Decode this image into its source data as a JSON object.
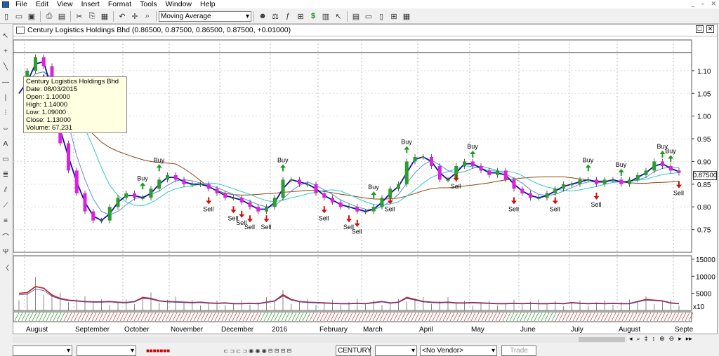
{
  "menu": [
    "File",
    "Edit",
    "View",
    "Insert",
    "Format",
    "Tools",
    "Window",
    "Help"
  ],
  "toolbar": {
    "indicator_select": "Moving Average"
  },
  "chart_window": {
    "title": "Century Logistics Holdings Bhd (0.86500, 0.87500, 0.86500, 0.87500, +0.01000)"
  },
  "tooltip": {
    "name": "Century Logistics Holdings Bhd",
    "date": "Date: 08/03/2015",
    "open": "Open: 1.10000",
    "high": "High: 1.14000",
    "low": "Low: 1.09000",
    "close": "Close: 1.13000",
    "volume": "Volume: 67,231"
  },
  "last_price": "0.87500",
  "volume_multiplier": "x10",
  "bottom": {
    "exchange": "CENTURY",
    "vendor": "<No Vendor>",
    "trade_label": "Trade"
  },
  "colors": {
    "up": "#2aa02a",
    "down": "#e020e0",
    "ma_fast": "#1010a0",
    "ma_mid": "#30c8c8",
    "ma_slow": "#8b4513",
    "volume_ma": "#cc2222",
    "buy_arrow": "#1a9a1a",
    "sell_arrow": "#d01010"
  },
  "chart_data": {
    "type": "line",
    "price_panel": {
      "ylim": [
        0.7,
        1.14
      ],
      "yticks": [
        "1.10",
        "1.05",
        "1.00",
        "0.95",
        "0.90",
        "0.85",
        "0.80",
        "0.75"
      ],
      "series_close": [
        1.05,
        1.1,
        1.13,
        1.11,
        1.0,
        0.94,
        0.88,
        0.83,
        0.79,
        0.77,
        0.77,
        0.8,
        0.82,
        0.83,
        0.82,
        0.82,
        0.84,
        0.86,
        0.87,
        0.86,
        0.85,
        0.85,
        0.85,
        0.84,
        0.83,
        0.82,
        0.82,
        0.81,
        0.8,
        0.79,
        0.8,
        0.82,
        0.86,
        0.86,
        0.85,
        0.85,
        0.83,
        0.82,
        0.81,
        0.8,
        0.8,
        0.79,
        0.79,
        0.8,
        0.82,
        0.84,
        0.85,
        0.9,
        0.91,
        0.91,
        0.89,
        0.86,
        0.86,
        0.89,
        0.9,
        0.89,
        0.88,
        0.87,
        0.88,
        0.86,
        0.84,
        0.83,
        0.82,
        0.82,
        0.83,
        0.84,
        0.85,
        0.85,
        0.86,
        0.86,
        0.85,
        0.86,
        0.86,
        0.85,
        0.86,
        0.87,
        0.88,
        0.9,
        0.89,
        0.88,
        0.875
      ],
      "ma_labels": [],
      "signals": [
        {
          "i": 3,
          "type": "Sell"
        },
        {
          "i": 15,
          "type": "Buy"
        },
        {
          "i": 17,
          "type": "Buy"
        },
        {
          "i": 23,
          "type": "Sell"
        },
        {
          "i": 26,
          "type": "Sell"
        },
        {
          "i": 27,
          "type": "Sell"
        },
        {
          "i": 28,
          "type": "Sell"
        },
        {
          "i": 30,
          "type": "Sell"
        },
        {
          "i": 32,
          "type": "Buy"
        },
        {
          "i": 37,
          "type": "Sell"
        },
        {
          "i": 40,
          "type": "Sell"
        },
        {
          "i": 41,
          "type": "Sell"
        },
        {
          "i": 43,
          "type": "Buy"
        },
        {
          "i": 45,
          "type": "Sell"
        },
        {
          "i": 47,
          "type": "Buy"
        },
        {
          "i": 53,
          "type": "Sell"
        },
        {
          "i": 55,
          "type": "Buy"
        },
        {
          "i": 60,
          "type": "Sell"
        },
        {
          "i": 65,
          "type": "Sell"
        },
        {
          "i": 69,
          "type": "Buy"
        },
        {
          "i": 70,
          "type": "Sell"
        },
        {
          "i": 73,
          "type": "Buy"
        },
        {
          "i": 78,
          "type": "Buy"
        },
        {
          "i": 79,
          "type": "Buy"
        },
        {
          "i": 80,
          "type": "Sell"
        }
      ]
    },
    "volume_panel": {
      "ylim": [
        0,
        16000
      ],
      "yticks": [
        "15000",
        "10000",
        "5000"
      ],
      "ma_values": [
        5000,
        5200,
        7000,
        6500,
        4500,
        3500,
        3000,
        2800,
        2600,
        2500,
        2500,
        2600,
        2400,
        2300,
        2600,
        3800,
        3500,
        2800,
        2600,
        2500,
        2400,
        2300,
        2400,
        2200,
        2100,
        2200,
        2000,
        2000,
        2100,
        2000,
        2400,
        2800,
        4600,
        3200,
        2600,
        2400,
        2300,
        2200,
        2100,
        2000,
        2000,
        2100,
        2000,
        2300,
        2600,
        2200,
        2400,
        3800,
        3200,
        2600,
        2400,
        2300,
        2400,
        2200,
        2200,
        2300,
        2200,
        2100,
        2000,
        2000,
        2100,
        2000,
        2100,
        2000,
        2000,
        2100,
        2000,
        2300,
        2100,
        2000,
        2100,
        2000,
        2100,
        2000,
        2000,
        2600,
        3200,
        3000,
        2800,
        2200,
        2000
      ]
    },
    "x_labels": [
      "August",
      "September",
      "October",
      "November",
      "December",
      "2016",
      "February",
      "March",
      "April",
      "May",
      "June",
      "July",
      "August",
      "Septe"
    ]
  }
}
